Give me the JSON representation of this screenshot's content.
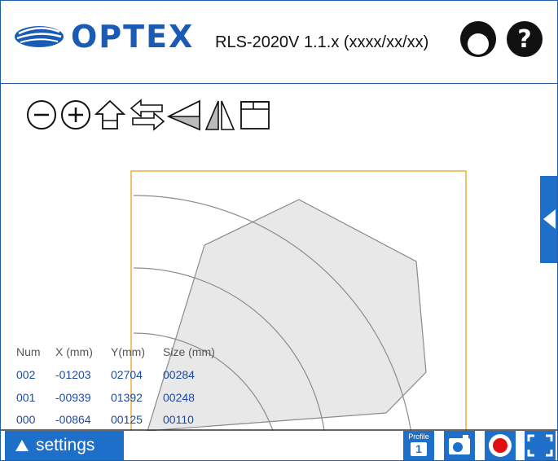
{
  "header": {
    "brand": "OPTEX",
    "version": "RLS-2020V 1.1.x (xxxx/xx/xx)"
  },
  "toolbar": {
    "tools": [
      "zoom-out",
      "zoom-in",
      "home",
      "swap",
      "perspective",
      "mirror",
      "window-layout"
    ]
  },
  "targets": {
    "columns": [
      "Num",
      "X (mm)",
      "Y(mm)",
      "Size (mm)"
    ],
    "rows": [
      [
        "002",
        "-01203",
        "02704",
        "00284"
      ],
      [
        "001",
        "-00939",
        "01392",
        "00248"
      ],
      [
        "000",
        "-00864",
        "00125",
        "00110"
      ]
    ]
  },
  "footer": {
    "settings_label": "settings",
    "profile_label": "Profile",
    "profile_number": "1"
  },
  "colors": {
    "accent": "#1e6fc9",
    "brand": "#1a5bb5",
    "zone_border": "#e8a020",
    "detection_fill": "#e8e8e8",
    "data_text": "#1c4aa0"
  }
}
